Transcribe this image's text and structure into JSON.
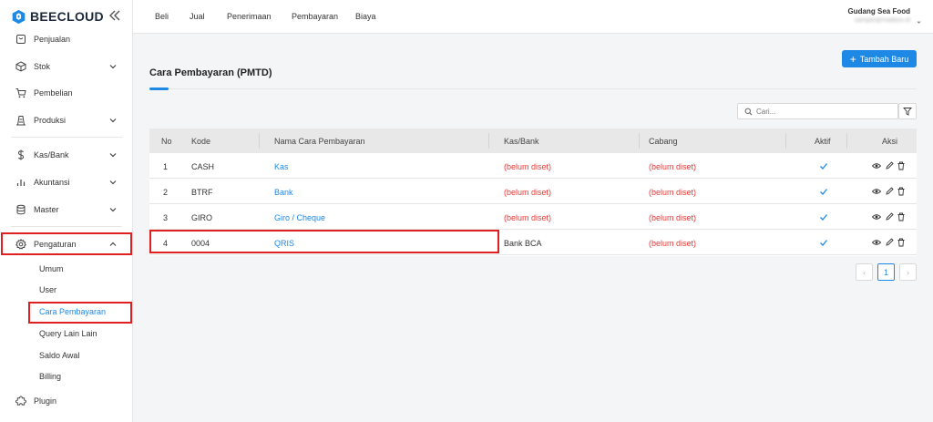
{
  "app": {
    "logo_text": "BEECLOUD"
  },
  "sidebar": {
    "items": [
      {
        "label": "Penjualan",
        "icon": "receipt-icon"
      },
      {
        "label": "Stok",
        "icon": "cube-icon"
      },
      {
        "label": "Pembelian",
        "icon": "cart-icon"
      },
      {
        "label": "Produksi",
        "icon": "factory-icon"
      },
      {
        "label": "Kas/Bank",
        "icon": "dollar-icon"
      },
      {
        "label": "Akuntansi",
        "icon": "bar-chart-icon"
      },
      {
        "label": "Master",
        "icon": "database-icon"
      },
      {
        "label": "Pengaturan",
        "icon": "gear-icon"
      },
      {
        "label": "Plugin",
        "icon": "puzzle-icon"
      }
    ],
    "sub_items": [
      "Umum",
      "User",
      "Cara Pembayaran",
      "Query Lain Lain",
      "Saldo Awal",
      "Billing"
    ]
  },
  "topnav": [
    "Beli",
    "Jual",
    "Penerimaan",
    "Pembayaran",
    "Biaya"
  ],
  "user": {
    "company": "Gudang Sea Food",
    "email": "sample@mailbox.id"
  },
  "page": {
    "title": "Cara Pembayaran (PMTD)",
    "add_button": "Tambah Baru",
    "search_placeholder": "Cari..."
  },
  "table": {
    "headers": [
      "No",
      "Kode",
      "Nama Cara Pembayaran",
      "Kas/Bank",
      "Cabang",
      "Aktif",
      "Aksi"
    ],
    "rows": [
      {
        "no": "1",
        "kode": "CASH",
        "nama": "Kas",
        "kasbank": "(belum diset)",
        "cabang": "(belum diset)",
        "aktif": true
      },
      {
        "no": "2",
        "kode": "BTRF",
        "nama": "Bank",
        "kasbank": "(belum diset)",
        "cabang": "(belum diset)",
        "aktif": true
      },
      {
        "no": "3",
        "kode": "GIRO",
        "nama": "Giro / Cheque",
        "kasbank": "(belum diset)",
        "cabang": "(belum diset)",
        "aktif": true
      },
      {
        "no": "4",
        "kode": "0004",
        "nama": "QRIS",
        "kasbank": "Bank BCA",
        "cabang": "(belum diset)",
        "aktif": true
      }
    ]
  },
  "pagination": {
    "current": "1",
    "prev": "‹",
    "next": "›"
  },
  "colors": {
    "accent": "#1e88e5",
    "warning": "#e53935",
    "highlight": "#e02020"
  }
}
